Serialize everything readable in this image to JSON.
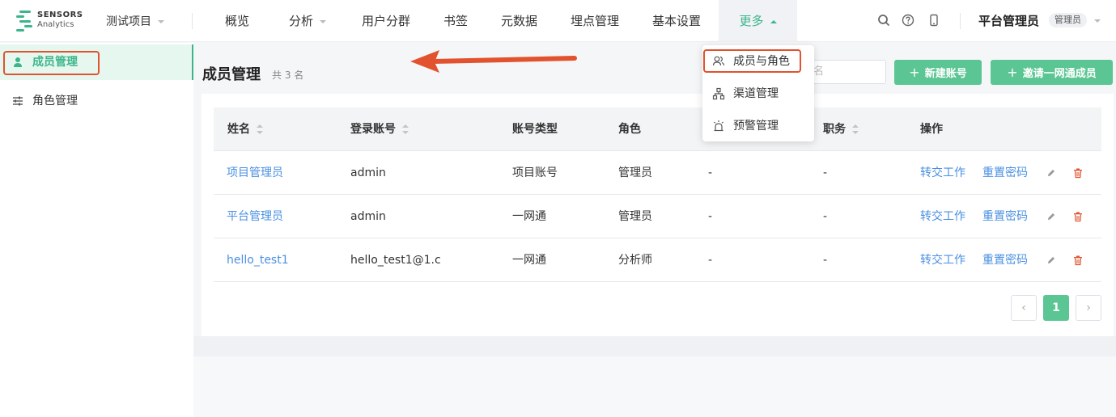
{
  "brand": {
    "line1": "SENSORS",
    "line2": "Analytics",
    "accent": "#3cb58a"
  },
  "project": {
    "label": "测试项目"
  },
  "nav": {
    "items": [
      {
        "label": "概览"
      },
      {
        "label": "分析"
      },
      {
        "label": "用户分群"
      },
      {
        "label": "书签"
      },
      {
        "label": "元数据"
      },
      {
        "label": "埋点管理"
      },
      {
        "label": "基本设置"
      },
      {
        "label": "更多"
      }
    ],
    "icons": [
      "search-icon",
      "help-icon",
      "mobile-icon"
    ]
  },
  "user": {
    "name": "平台管理员",
    "role": "管理员"
  },
  "sidebar": {
    "items": [
      {
        "label": "成员管理",
        "icon": "user-icon"
      },
      {
        "label": "角色管理",
        "icon": "sliders-icon"
      }
    ]
  },
  "main": {
    "title": "成员管理",
    "count": "共 3 名",
    "search_placeholder": "名",
    "new_account_label": "新建账号",
    "invite_label": "邀请一网通成员"
  },
  "table": {
    "headers": [
      "姓名",
      "登录账号",
      "账号类型",
      "角色",
      "职务",
      "操作"
    ],
    "rows": [
      {
        "name": "项目管理员",
        "account": "admin",
        "type": "项目账号",
        "role": "管理员",
        "col5": "-",
        "title": "-",
        "transfer": "转交工作",
        "reset": "重置密码"
      },
      {
        "name": "平台管理员",
        "account": "admin",
        "type": "一网通",
        "role": "管理员",
        "col5": "-",
        "title": "-",
        "transfer": "转交工作",
        "reset": "重置密码"
      },
      {
        "name": "hello_test1",
        "account": "hello_test1@1.c",
        "type": "一网通",
        "role": "分析师",
        "col5": "-",
        "title": "-",
        "transfer": "转交工作",
        "reset": "重置密码"
      }
    ]
  },
  "pagination": {
    "prev": "‹",
    "current": "1",
    "next": "›"
  },
  "dropdown": {
    "items": [
      {
        "label": "成员与角色",
        "icon": "users-icon"
      },
      {
        "label": "渠道管理",
        "icon": "channel-icon"
      },
      {
        "label": "预警管理",
        "icon": "alarm-icon"
      }
    ]
  },
  "colors": {
    "green": "#5bc693",
    "link": "#4a90e2",
    "highlight": "#e2522e",
    "delete": "#e2522e"
  }
}
